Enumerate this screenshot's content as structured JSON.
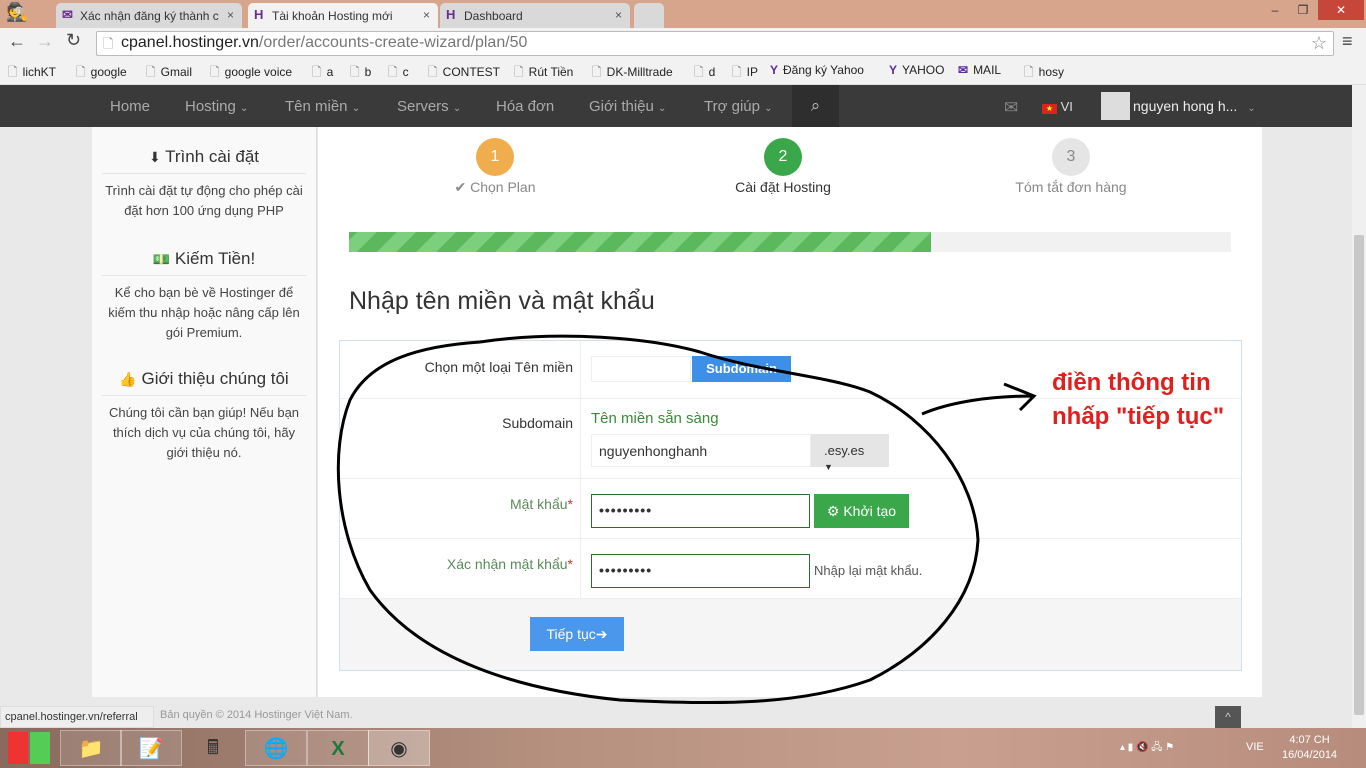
{
  "browser": {
    "tabs": [
      {
        "label": "Xác nhận đăng ký thành c",
        "icon": "mail-icon",
        "active": false
      },
      {
        "label": "Tài khoản Hosting mới",
        "icon": "hostinger-icon",
        "active": true
      },
      {
        "label": "Dashboard",
        "icon": "hostinger-icon",
        "active": false
      }
    ],
    "url_host": "cpanel.hostinger.vn",
    "url_path": "/order/accounts-create-wizard/plan/50",
    "bookmarks": [
      "lichKT",
      "google",
      "Gmail",
      "google voice",
      "a",
      "b",
      "c",
      "CONTEST",
      "Rút Tiền",
      "DK-Milltrade",
      "d",
      "IP",
      "Đăng ký Yahoo",
      "YAHOO",
      "MAIL",
      "hosy"
    ],
    "status_url": "cpanel.hostinger.vn/referral"
  },
  "nav": {
    "items": [
      "Home",
      "Hosting",
      "Tên miền",
      "Servers",
      "Hóa đơn",
      "Giới thiệu",
      "Trợ giúp"
    ],
    "lang": "VI",
    "user": "nguyen hong h..."
  },
  "sidebar": [
    {
      "title": "Trình cài đặt",
      "icon": "download-icon",
      "text": "Trình cài đặt tự động cho phép cài đặt hơn 100 ứng dụng PHP"
    },
    {
      "title": "Kiếm Tiền!",
      "icon": "money-icon",
      "text": "Kể cho bạn bè về Hostinger để kiếm thu nhập hoặc nâng cấp lên gói Premium."
    },
    {
      "title": "Giới thiệu chúng tôi",
      "icon": "thumbs-up-icon",
      "text": "Chúng tôi cần bạn giúp! Nếu bạn thích dịch vụ của chúng tôi, hãy giới thiệu nó."
    }
  ],
  "wizard": {
    "steps": [
      {
        "num": "1",
        "label": "Chọn Plan",
        "color": "#f0ad4e"
      },
      {
        "num": "2",
        "label": "Cài đặt Hosting",
        "color": "#3aa84a"
      },
      {
        "num": "3",
        "label": "Tóm tắt đơn hàng",
        "color": "#e5e5e5"
      }
    ],
    "progress_percent": 66
  },
  "form": {
    "heading": "Nhập tên miền và mật khẩu",
    "domain_type_label": "Chọn một loại Tên miền",
    "domain_type_button": "Subdomain",
    "subdomain_label": "Subdomain",
    "availability": "Tên miền sẵn sàng",
    "subdomain_value": "nguyenhonghanh",
    "suffix": ".esy.es",
    "password_label": "Mật khẩu",
    "password_value": "•••••••••",
    "generate_button": "Khởi tạo",
    "confirm_label": "Xác nhận mật khẩu",
    "confirm_value": "•••••••••",
    "confirm_help": "Nhập lại mật khẩu.",
    "submit": "Tiếp tục"
  },
  "footer": "Bản quyền © 2014 Hostinger Việt Nam.",
  "annotation": {
    "line1": "điền thông tin",
    "line2": "nhấp \"tiếp tục\"",
    "color": "#e0201e"
  },
  "taskbar": {
    "lang": "VIE",
    "time": "4:07 CH",
    "date": "16/04/2014"
  }
}
